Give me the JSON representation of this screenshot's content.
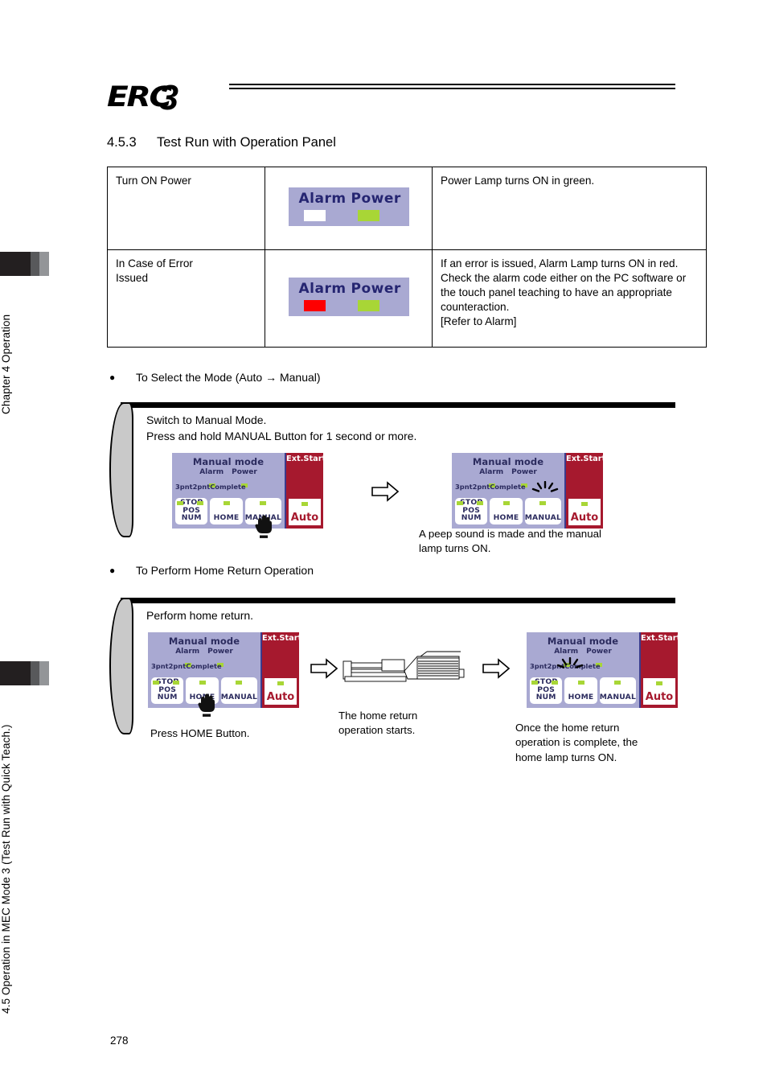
{
  "sidebar": {
    "chapter_label": "Chapter 4 Operation",
    "section_label": "4.5 Operation in MEC Mode 3 (Test Run with Quick Teach.)"
  },
  "header": {
    "logo_main": "ERC",
    "logo_sup": "3"
  },
  "section": {
    "number": "4.5.3",
    "title": "Test Run with Operation Panel"
  },
  "table": {
    "rows": [
      {
        "action": "Turn ON Power",
        "lamp": {
          "alarm_label": "Alarm",
          "power_label": "Power",
          "alarm_state": "off",
          "power_state": "green"
        },
        "result": "Power Lamp turns ON in green."
      },
      {
        "action": "In Case of Error\nIssued",
        "lamp": {
          "alarm_label": "Alarm",
          "power_label": "Power",
          "alarm_state": "red",
          "power_state": "green"
        },
        "result": "If an error is issued, Alarm Lamp turns ON in red. Check the alarm code either on the PC software or the touch panel teaching to have an appropriate counteraction.\n[Refer to Alarm]"
      }
    ]
  },
  "bullets": {
    "mode_select": "To Select the Mode (Auto → Manual)",
    "home_return": "To Perform Home Return Operation"
  },
  "callout1": {
    "line1": "Switch to Manual Mode.",
    "line2": "Press and hold MANUAL Button for 1 second or more.",
    "caption_right": "A peep sound is made and the manual\nlamp turns ON."
  },
  "callout2": {
    "line1": "Perform home return.",
    "caption_left": "Press HOME Button.",
    "caption_mid": "The home return\noperation starts.",
    "caption_right": "Once the home return\noperation is complete, the\nhome lamp turns ON."
  },
  "panel": {
    "mode_text": "Manual mode",
    "alarm_label": "Alarm",
    "power_label": "Power",
    "sub_3pnt": "3pnt",
    "sub_2pnt": "2pnt",
    "sub_complete": "Complete",
    "btn_stop_line1": "STOP",
    "btn_stop_line2": "POS NUM",
    "btn_home": "HOME",
    "btn_manual": "MANUAL",
    "ext_start": "Ext.Start",
    "auto": "Auto"
  },
  "colors": {
    "panel_bg": "#a9a9d2",
    "panel_text": "#2b2b5e",
    "led_green": "#a8d636",
    "led_red": "#fe0000",
    "red_panel": "#a6192e",
    "lamp_label": "#252571",
    "tab_dark": "#231f20",
    "tab_mid": "#58595b",
    "tab_light": "#939598"
  },
  "footer": {
    "page_number": "278"
  }
}
